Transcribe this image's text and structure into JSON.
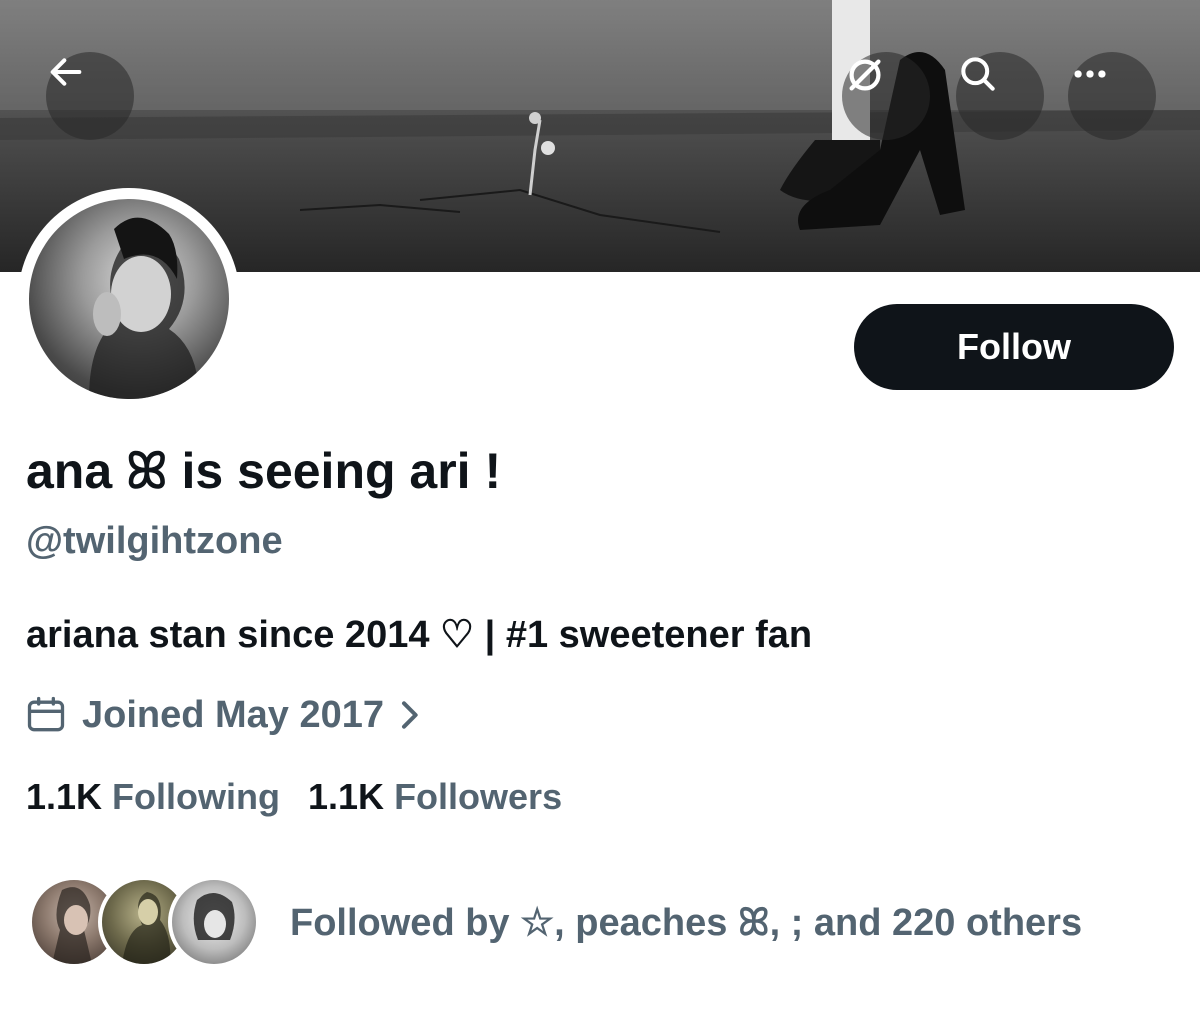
{
  "profile": {
    "display_name": "ana ꕤ is seeing ari !",
    "handle": "@twilgihtzone",
    "bio": "ariana stan since 2014 ♡ | #1 sweetener fan",
    "joined": "Joined May 2017",
    "following_count": "1.1K",
    "following_label": "Following",
    "followers_count": "1.1K",
    "followers_label": "Followers",
    "followed_by": "Followed by ☆, peaches ꕤ, ; and 220 others"
  },
  "actions": {
    "follow_label": "Follow"
  },
  "icons": {
    "back": "arrow-left-icon",
    "hide": "eye-slash-icon",
    "search": "search-icon",
    "more": "more-dots-icon",
    "calendar": "calendar-icon",
    "chevron": "chevron-right-icon"
  },
  "colors": {
    "text_primary": "#0f1419",
    "text_secondary": "#536471",
    "button_bg": "#0f1419",
    "button_text": "#ffffff"
  }
}
